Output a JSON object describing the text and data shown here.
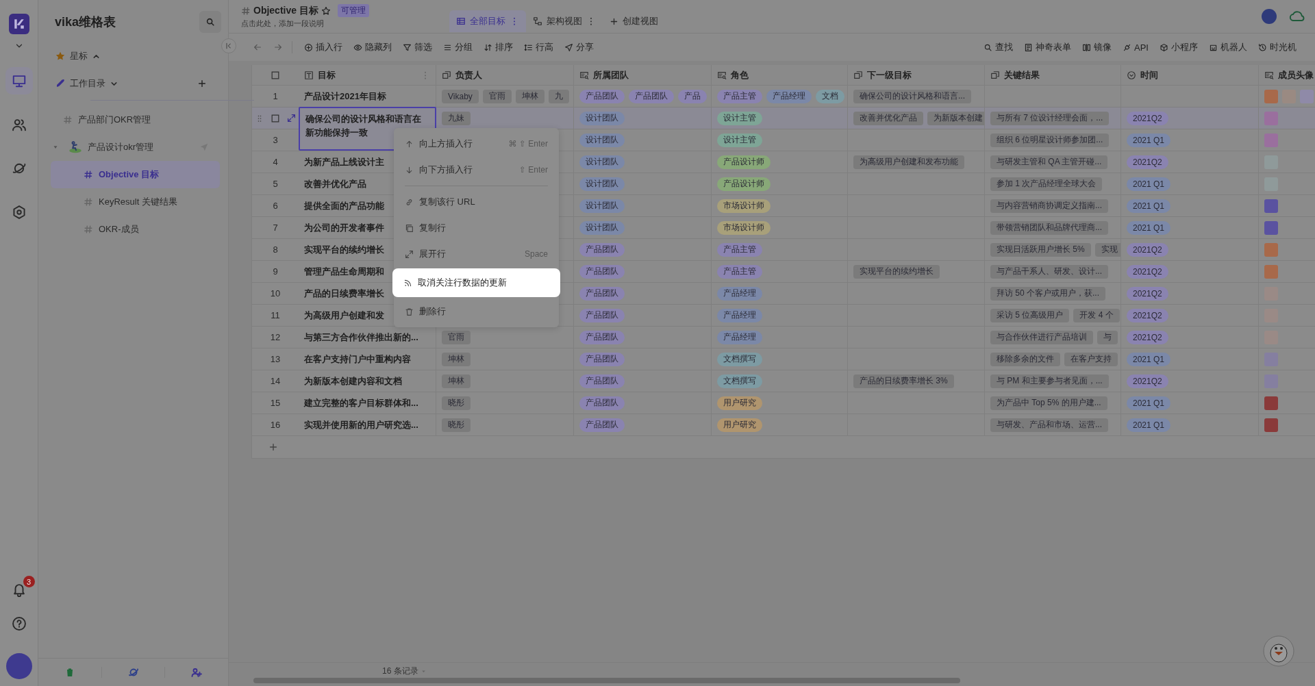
{
  "rail": {
    "items": [
      {
        "selected": true
      },
      {
        "selected": false
      },
      {
        "selected": false
      },
      {
        "selected": false
      }
    ],
    "notification_badge": "3"
  },
  "sidebar": {
    "title": "vika维格表",
    "sections": [
      {
        "label": "星标",
        "expanded": true
      },
      {
        "label": "工作目录",
        "expanded": false
      }
    ],
    "tree": [
      {
        "label": "产品部门OKR管理",
        "selected": false
      },
      {
        "label": "产品设计okr管理",
        "selected": false,
        "expanded": true,
        "children": [
          {
            "label": "Objective 目标",
            "selected": true
          },
          {
            "label": "KeyResult 关键结果",
            "selected": false
          },
          {
            "label": "OKR-成员",
            "selected": false
          }
        ]
      }
    ]
  },
  "header": {
    "title": "Objective 目标",
    "badge": "可管理",
    "description": "点击此处，添加一段说明",
    "views": [
      {
        "label": "全部目标",
        "selected": true
      },
      {
        "label": "架构视图",
        "selected": false
      }
    ],
    "create_view": "创建视图"
  },
  "toolbar": {
    "left": [
      "插入行",
      "隐藏列",
      "筛选",
      "分组",
      "排序",
      "行高",
      "分享"
    ],
    "right": [
      "查找",
      "神奇表单",
      "镜像",
      "API",
      "小程序",
      "机器人",
      "时光机"
    ]
  },
  "table": {
    "all_selected": false,
    "columns": [
      "目标",
      "负责人",
      "所属团队",
      "角色",
      "下一级目标",
      "关键结果",
      "时间",
      "成员头像"
    ],
    "rows": [
      {
        "number": "1",
        "active": false,
        "goal": "产品设计2021年目标",
        "owners": [
          "Vikaby",
          "官雨",
          "坤林",
          "九"
        ],
        "teams": [
          {
            "text": "产品团队",
            "color": "#8a83b0"
          },
          {
            "text": "产品团队",
            "color": "#8a83b0"
          },
          {
            "text": "产品",
            "color": "#8a83b0"
          }
        ],
        "roles": [
          {
            "text": "产品主管",
            "color": "#8a83b0"
          },
          {
            "text": "产品经理",
            "color": "#7b88a8"
          },
          {
            "text": "文档",
            "color": "#7d9ba3"
          }
        ],
        "sub_goals": [
          "确保公司的设计风格和语言..."
        ],
        "key_results": [],
        "avatars": [
          {
            "color": "#a8694a"
          },
          {
            "color": "#9a8a82"
          },
          {
            "color": "#8f8aa8"
          }
        ]
      },
      {
        "active": true,
        "checked": false,
        "goal": "确保公司的设计风格和语言在新功能保持一致",
        "owners": [
          "九妹"
        ],
        "teams": [
          {
            "text": "设计团队",
            "color": "#7b88a8"
          }
        ],
        "roles": [
          {
            "text": "设计主管",
            "color": "#7ea596"
          }
        ],
        "sub_goals": [
          "改善并优化产品",
          "为新版本创建"
        ],
        "key_results": [
          "与所有 7 位设计经理会面，..."
        ],
        "time": {
          "text": "2021Q2",
          "color": "#8a83b0"
        },
        "avatars": [
          {
            "color": "#9a6f9e"
          }
        ]
      },
      {
        "number": "3",
        "active": false,
        "owners": [],
        "teams": [
          {
            "text": "设计团队",
            "color": "#7b88a8"
          }
        ],
        "roles": [
          {
            "text": "设计主管",
            "color": "#7ea596"
          }
        ],
        "sub_goals": [],
        "key_results": [
          "组织 6 位明星设计师参加团..."
        ],
        "time": {
          "text": "2021 Q1",
          "color": "#7b88a8"
        },
        "avatars": [
          {
            "color": "#9a6f9e"
          }
        ]
      },
      {
        "number": "4",
        "active": false,
        "goal": "为新产品上线设计主",
        "owners": [],
        "teams": [
          {
            "text": "设计团队",
            "color": "#7b88a8"
          }
        ],
        "roles": [
          {
            "text": "产品设计师",
            "color": "#88a878"
          }
        ],
        "sub_goals": [
          "为高级用户创建和发布功能"
        ],
        "key_results": [
          "与研发主管和 QA 主管开碰..."
        ],
        "time": {
          "text": "2021Q2",
          "color": "#8a83b0"
        },
        "avatars": [
          {
            "color": "#8f9a9a"
          }
        ]
      },
      {
        "number": "5",
        "active": false,
        "goal": "改善并优化产品",
        "owners": [],
        "teams": [
          {
            "text": "设计团队",
            "color": "#7b88a8"
          }
        ],
        "roles": [
          {
            "text": "产品设计师",
            "color": "#88a878"
          }
        ],
        "sub_goals": [],
        "key_results": [
          "参加 1 次产品经理全球大会"
        ],
        "time": {
          "text": "2021 Q1",
          "color": "#7b88a8"
        },
        "avatars": [
          {
            "color": "#8f9a9a"
          }
        ]
      },
      {
        "number": "6",
        "active": false,
        "goal": "提供全面的产品功能",
        "owners": [],
        "teams": [
          {
            "text": "设计团队",
            "color": "#7b88a8"
          }
        ],
        "roles": [
          {
            "text": "市场设计师",
            "color": "#a8a07a"
          }
        ],
        "sub_goals": [],
        "key_results": [
          "与内容营销商协调定义指南..."
        ],
        "time": {
          "text": "2021 Q1",
          "color": "#7b88a8"
        },
        "avatars": [
          {
            "color": "#5a52a0"
          }
        ]
      },
      {
        "number": "7",
        "active": false,
        "goal": "为公司的开发者事件",
        "owners": [],
        "teams": [
          {
            "text": "设计团队",
            "color": "#7b88a8"
          }
        ],
        "roles": [
          {
            "text": "市场设计师",
            "color": "#a8a07a"
          }
        ],
        "sub_goals": [],
        "key_results": [
          "带领营销团队和品牌代理商..."
        ],
        "time": {
          "text": "2021 Q1",
          "color": "#7b88a8"
        },
        "avatars": [
          {
            "color": "#5a52a0"
          }
        ]
      },
      {
        "number": "8",
        "active": false,
        "goal": "实现平台的续约增长",
        "owners": [],
        "teams": [
          {
            "text": "产品团队",
            "color": "#8a83b0"
          }
        ],
        "roles": [
          {
            "text": "产品主管",
            "color": "#8a83b0"
          }
        ],
        "sub_goals": [],
        "key_results": [
          "实现日活跃用户增长 5%",
          "实现"
        ],
        "time": {
          "text": "2021Q2",
          "color": "#8a83b0"
        },
        "avatars": [
          {
            "color": "#a8694a"
          }
        ]
      },
      {
        "number": "9",
        "active": false,
        "goal": "管理产品生命周期和",
        "owners": [],
        "teams": [
          {
            "text": "产品团队",
            "color": "#8a83b0"
          }
        ],
        "roles": [
          {
            "text": "产品主管",
            "color": "#8a83b0"
          }
        ],
        "sub_goals": [
          "实现平台的续约增长"
        ],
        "key_results": [
          "与产品干系人、研发、设计..."
        ],
        "time": {
          "text": "2021Q2",
          "color": "#8a83b0"
        },
        "avatars": [
          {
            "color": "#a8694a"
          }
        ]
      },
      {
        "number": "10",
        "active": false,
        "goal": "产品的日续费率增长",
        "owners": [],
        "teams": [
          {
            "text": "产品团队",
            "color": "#8a83b0"
          }
        ],
        "roles": [
          {
            "text": "产品经理",
            "color": "#7b88a8"
          }
        ],
        "sub_goals": [],
        "key_results": [
          "拜访 50 个客户或用户，获..."
        ],
        "time": {
          "text": "2021Q2",
          "color": "#8a83b0"
        },
        "avatars": [
          {
            "color": "#9a8a86"
          }
        ]
      },
      {
        "number": "11",
        "active": false,
        "goal": "为高级用户创建和发",
        "owners": [],
        "teams": [
          {
            "text": "产品团队",
            "color": "#8a83b0"
          }
        ],
        "roles": [
          {
            "text": "产品经理",
            "color": "#7b88a8"
          }
        ],
        "sub_goals": [],
        "key_results": [
          "采访 5 位高级用户",
          "开发 4 个"
        ],
        "time": {
          "text": "2021Q2",
          "color": "#8a83b0"
        },
        "avatars": [
          {
            "color": "#9a8a86"
          }
        ]
      },
      {
        "number": "12",
        "active": false,
        "goal": "与第三方合作伙伴推出新的...",
        "owners": [
          "官雨"
        ],
        "teams": [
          {
            "text": "产品团队",
            "color": "#8a83b0"
          }
        ],
        "roles": [
          {
            "text": "产品经理",
            "color": "#7b88a8"
          }
        ],
        "sub_goals": [],
        "key_results": [
          "与合作伙伴进行产品培训",
          "与"
        ],
        "time": {
          "text": "2021Q2",
          "color": "#8a83b0"
        },
        "avatars": [
          {
            "color": "#9a8a86"
          }
        ]
      },
      {
        "number": "13",
        "active": false,
        "goal": "在客户支持门户中重构内容",
        "owners": [
          "坤林"
        ],
        "teams": [
          {
            "text": "产品团队",
            "color": "#8a83b0"
          }
        ],
        "roles": [
          {
            "text": "文档撰写",
            "color": "#7d9ba3"
          }
        ],
        "sub_goals": [],
        "key_results": [
          "移除多余的文件",
          "在客户支持"
        ],
        "time": {
          "text": "2021 Q1",
          "color": "#7b88a8"
        },
        "avatars": [
          {
            "color": "#857fa0"
          }
        ]
      },
      {
        "number": "14",
        "active": false,
        "goal": "为新版本创建内容和文档",
        "owners": [
          "坤林"
        ],
        "teams": [
          {
            "text": "产品团队",
            "color": "#8a83b0"
          }
        ],
        "roles": [
          {
            "text": "文档撰写",
            "color": "#7d9ba3"
          }
        ],
        "sub_goals": [
          "产品的日续费率增长 3%"
        ],
        "key_results": [
          "与 PM 和主要参与者见面，..."
        ],
        "time": {
          "text": "2021Q2",
          "color": "#8a83b0"
        },
        "avatars": [
          {
            "color": "#857fa0"
          }
        ]
      },
      {
        "number": "15",
        "active": false,
        "goal": "建立完整的客户目标群体和...",
        "owners": [
          "晓彤"
        ],
        "teams": [
          {
            "text": "产品团队",
            "color": "#8a83b0"
          }
        ],
        "roles": [
          {
            "text": "用户研究",
            "color": "#b0956e"
          }
        ],
        "sub_goals": [],
        "key_results": [
          "为产品中 Top 5% 的用户建..."
        ],
        "time": {
          "text": "2021 Q1",
          "color": "#7b88a8"
        },
        "avatars": [
          {
            "color": "#8a3a3a"
          }
        ]
      },
      {
        "number": "16",
        "active": false,
        "goal": "实现并使用新的用户研究选...",
        "owners": [
          "晓彤"
        ],
        "teams": [
          {
            "text": "产品团队",
            "color": "#8a83b0"
          }
        ],
        "roles": [
          {
            "text": "用户研究",
            "color": "#b0956e"
          }
        ],
        "sub_goals": [],
        "key_results": [
          "与研发、产品和市场、运营..."
        ],
        "time": {
          "text": "2021 Q1",
          "color": "#7b88a8"
        },
        "avatars": [
          {
            "color": "#8a3a3a"
          }
        ]
      }
    ]
  },
  "context_menu": {
    "items": [
      {
        "kind": "item",
        "label": "向上方插入行",
        "shortcut": "⌘ ⇧ Enter",
        "highlighted": false
      },
      {
        "kind": "item",
        "label": "向下方插入行",
        "shortcut": "⇧ Enter",
        "highlighted": false
      },
      {
        "kind": "divider"
      },
      {
        "kind": "item",
        "label": "复制该行 URL",
        "highlighted": false
      },
      {
        "kind": "item",
        "label": "复制行",
        "highlighted": false
      },
      {
        "kind": "item",
        "label": "展开行",
        "shortcut": "Space",
        "highlighted": false
      },
      {
        "kind": "item",
        "label": "取消关注行数据的更新",
        "highlighted": true
      },
      {
        "kind": "item",
        "label": "删除行",
        "highlighted": false
      }
    ]
  },
  "footer": {
    "record_count": "16 条记录"
  }
}
